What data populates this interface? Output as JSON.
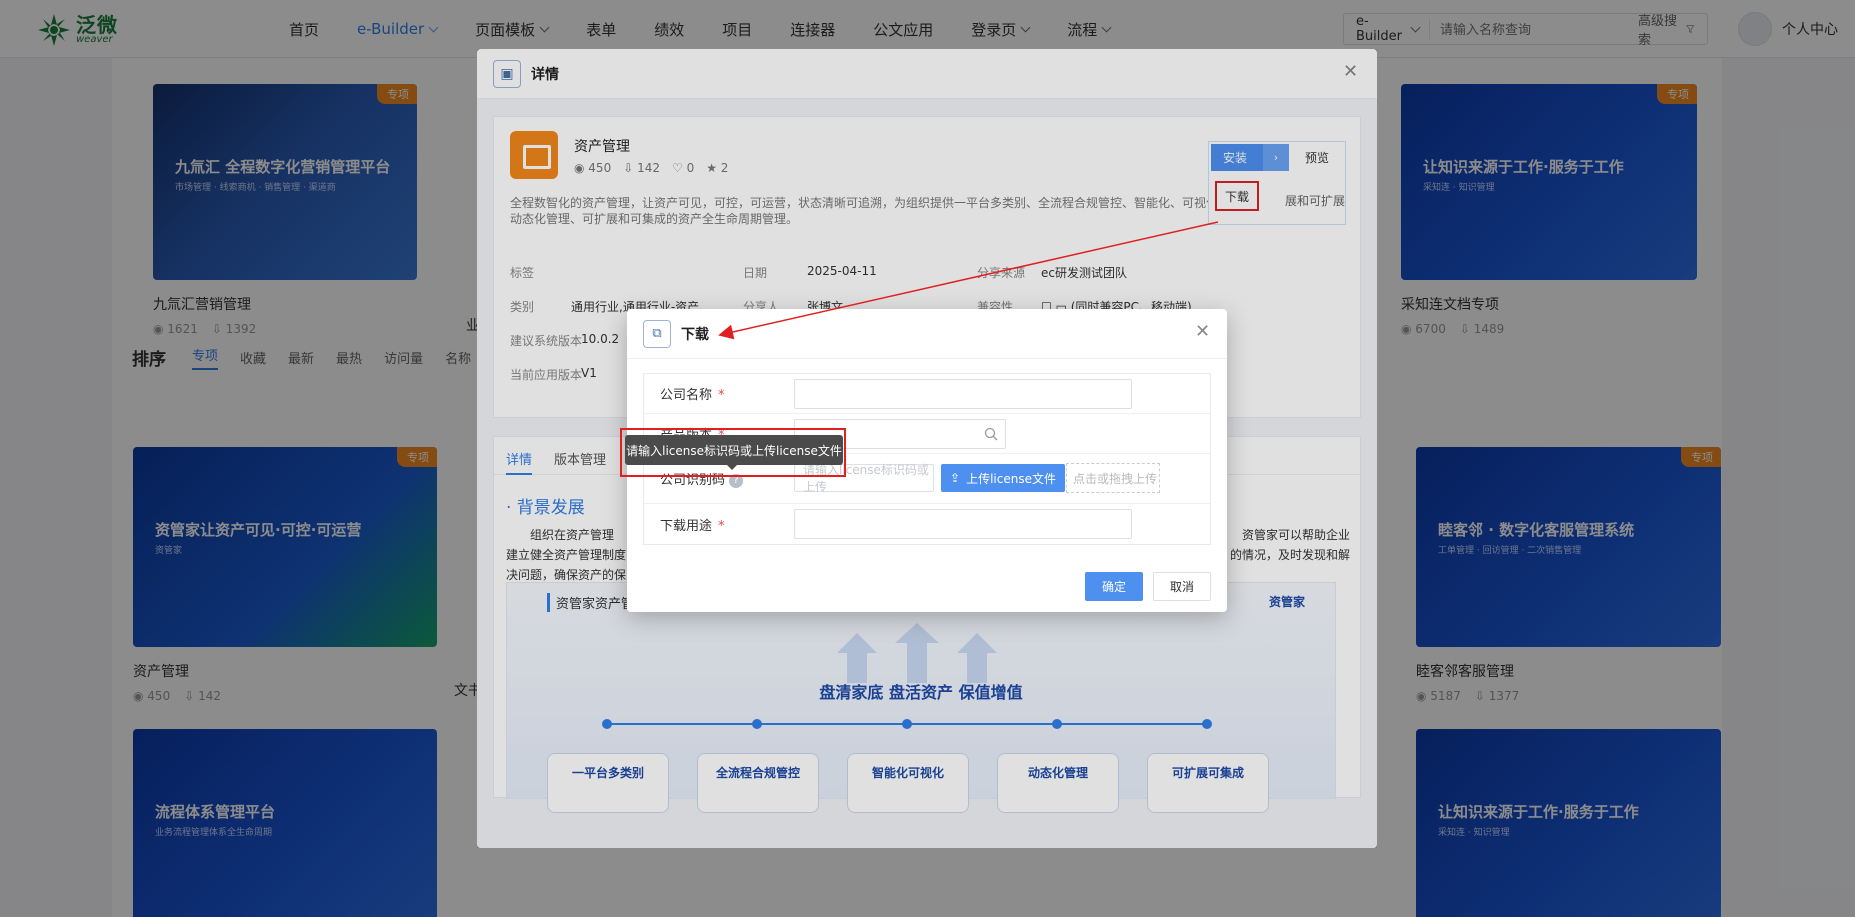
{
  "nav": {
    "logo_cn": "泛微",
    "logo_en": "weaver",
    "items": [
      {
        "label": "首页"
      },
      {
        "label": "e-Builder"
      },
      {
        "label": "页面模板"
      },
      {
        "label": "表单"
      },
      {
        "label": "绩效"
      },
      {
        "label": "项目"
      },
      {
        "label": "连接器"
      },
      {
        "label": "公文应用"
      },
      {
        "label": "登录页"
      },
      {
        "label": "流程"
      }
    ],
    "search_scope": "e-Builder",
    "search_placeholder": "请输入名称查询",
    "advanced_search": "高级搜索",
    "user_center": "个人中心"
  },
  "background": {
    "top_cards": [
      {
        "tag": "专项",
        "headline": "九氚汇 全程数字化营销管理平台",
        "sub": "市场管理 · 线索商机 · 销售管理 · 渠道商",
        "title": "九氚汇营销管理",
        "views": "1621",
        "downloads": "1392"
      },
      {
        "tag": "专项",
        "headline": "让知识来源于工作·服务于工作",
        "sub": "采知连 · 知识管理",
        "title": "采知连文档专项",
        "views": "6700",
        "downloads": "1489"
      }
    ],
    "left_cut_title": "业",
    "sort": {
      "title": "排序",
      "options": [
        "专项",
        "收藏",
        "最新",
        "最热",
        "访问量",
        "名称"
      ]
    },
    "mid_cards": [
      {
        "tag": "专项",
        "headline": "资管家让资产可见·可控·可运营",
        "sub": "资管家",
        "title": "资产管理",
        "views": "450",
        "downloads": "142"
      },
      {
        "tag": "专项",
        "headline": "睦客邻 · 数字化客服管理系统",
        "sub": "工单管理 · 回访管理 · 二次销售管理",
        "title": "睦客邻客服管理",
        "views": "5187",
        "downloads": "1377"
      }
    ],
    "left_cut_title2": "文书",
    "bottom_cards": [
      {
        "headline": "流程体系管理平台",
        "sub": "业务流程管理体系全生命周期"
      },
      {
        "headline": "让知识来源于工作·服务于工作",
        "sub": "采知连 · 知识管理"
      }
    ]
  },
  "detail": {
    "title": "详情",
    "app_name": "资产管理",
    "stats": {
      "views": "450",
      "downloads": "142",
      "likes": "0",
      "stars": "2"
    },
    "description": "全程数智化的资产管理，让资产可见，可控，可运营，状态清晰可追溯，为组织提供一平台多类别、全流程合规管控、智能化、可视化、动态化管理、可扩展和可集成的资产全生命周期管理。",
    "fields": {
      "tag_label": "标签",
      "date_label": "日期",
      "date_value": "2025-04-11",
      "source_label": "分享来源",
      "source_value": "ec研发测试团队",
      "category_label": "类别",
      "category_value": "通用行业,通用行业-资产",
      "sharer_label": "分享人",
      "sharer_value": "张博文",
      "terminal_label": "兼容性",
      "terminal_value": "(同时兼容PC、移动端)",
      "sys_version_label": "建议系统版本",
      "sys_version_value": "10.0.2",
      "app_version_label": "当前应用版本",
      "app_version_value": "V1"
    },
    "actions": {
      "install": "安装",
      "preview": "预览",
      "download": "下载",
      "ext_text": "展和可扩展"
    },
    "tabs": [
      "详情",
      "版本管理"
    ],
    "section_title": "· 背景发展",
    "paragraph_left": "组织在资产管理",
    "paragraph_right": "资管家可以帮助企业",
    "paragraph_line2_left": "建立健全资产管理制度",
    "paragraph_line2_right": "的情况，及时发现和解",
    "paragraph_line3_left": "决问题，确保资产的保",
    "illus_caption": "资管家资产管",
    "illus_brand": "资管家",
    "illus_slogan": "盘清家底 盘活资产 保值增值",
    "illus_pills": [
      "一平台多类别",
      "全流程合规管控",
      "智能化可视化",
      "动态化管理",
      "可扩展可集成"
    ]
  },
  "download_modal": {
    "title": "下载",
    "company_name_label": "公司名称",
    "edition_label": "产品版本",
    "company_code_label": "公司识别码",
    "code_placeholder": "请输入license标识码或上传",
    "upload_button": "上传license文件",
    "drop_hint": "点击或拖拽上传",
    "purpose_label": "下载用途",
    "tooltip": "请输入license标识码或上传license文件",
    "ok": "确定",
    "cancel": "取消"
  },
  "colors": {
    "accent": "#2f7fe8",
    "primary_button": "#4d90f0",
    "tag_orange": "#f08a24",
    "annotation_red": "#e02020"
  }
}
